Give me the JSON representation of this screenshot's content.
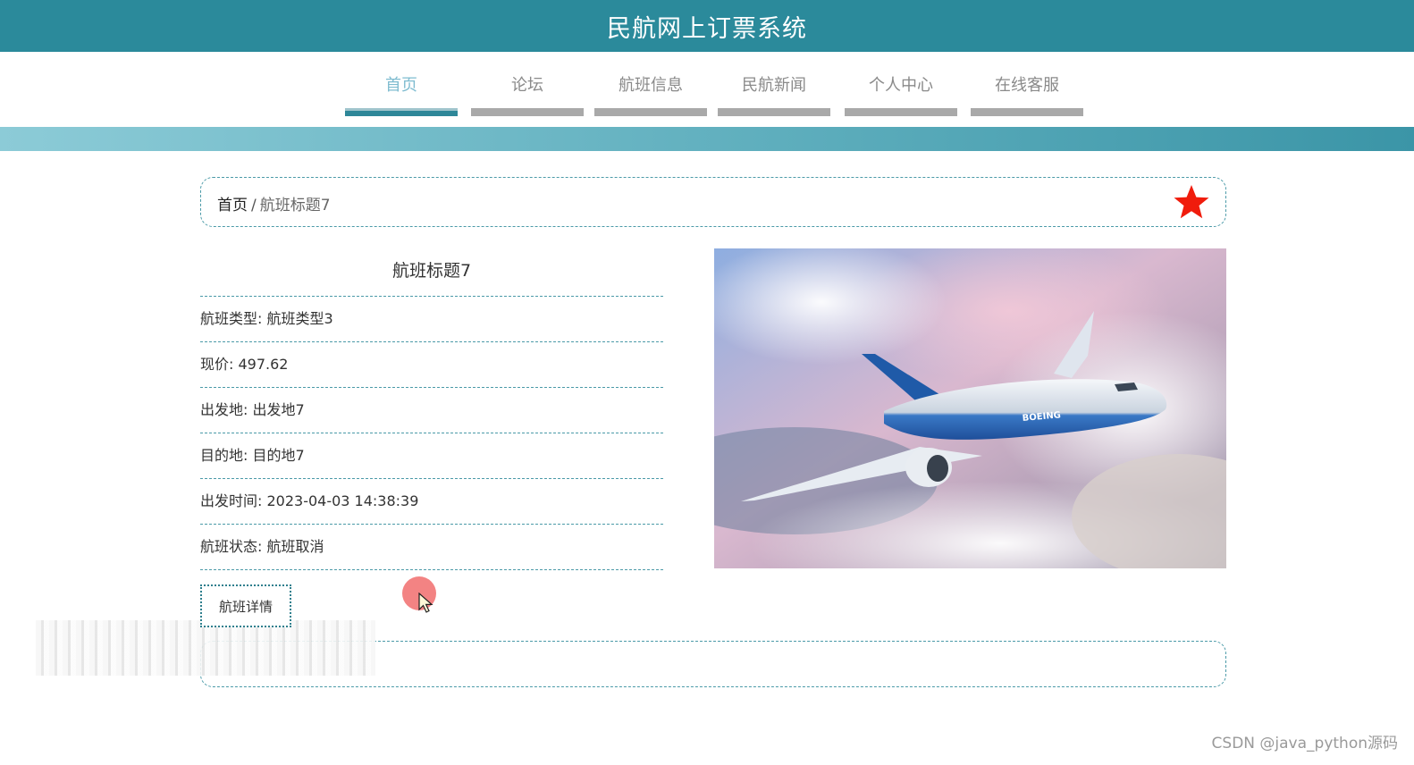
{
  "header": {
    "title": "民航网上订票系统"
  },
  "nav": [
    {
      "label": "首页"
    },
    {
      "label": "论坛"
    },
    {
      "label": "航班信息"
    },
    {
      "label": "民航新闻"
    },
    {
      "label": "个人中心"
    },
    {
      "label": "在线客服"
    }
  ],
  "breadcrumb": {
    "home": "首页",
    "separator": "/",
    "current": "航班标题7"
  },
  "flight": {
    "title": "航班标题7",
    "rows": [
      "航班类型: 航班类型3",
      "现价: 497.62",
      "出发地: 出发地7",
      "目的地: 目的地7",
      "出发时间: 2023-04-03 14:38:39",
      "航班状态: 航班取消"
    ],
    "image_livery_text": "BOEING"
  },
  "detail": {
    "tab_label": "航班详情"
  },
  "watermark": "CSDN @java_python源码",
  "colors": {
    "header": "#2b8a9b",
    "nav_active": "#7fbcd0",
    "star": "#f01c0c"
  },
  "icons": {
    "favorite": "star-icon"
  }
}
